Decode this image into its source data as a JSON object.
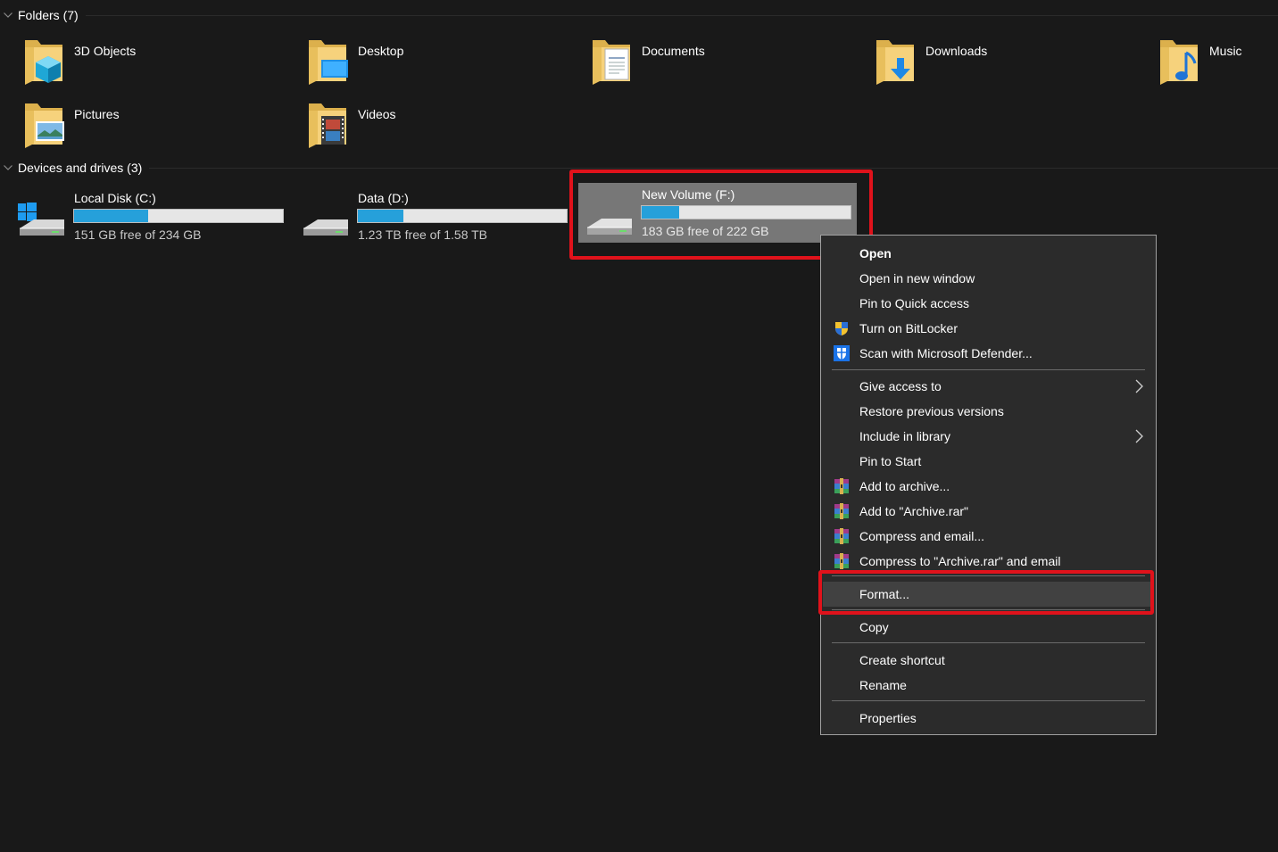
{
  "folders_group": {
    "title": "Folders (7)"
  },
  "folders": [
    {
      "name": "3D Objects",
      "icon": "3d-objects-folder-icon"
    },
    {
      "name": "Desktop",
      "icon": "desktop-folder-icon"
    },
    {
      "name": "Documents",
      "icon": "documents-folder-icon"
    },
    {
      "name": "Downloads",
      "icon": "downloads-folder-icon"
    },
    {
      "name": "Music",
      "icon": "music-folder-icon"
    },
    {
      "name": "Pictures",
      "icon": "pictures-folder-icon"
    },
    {
      "name": "Videos",
      "icon": "videos-folder-icon"
    }
  ],
  "drives_group": {
    "title": "Devices and drives (3)"
  },
  "drives": [
    {
      "name": "Local Disk (C:)",
      "free": "151 GB free of 234 GB",
      "used_fraction": 0.355,
      "icon": "windows-drive-icon"
    },
    {
      "name": "Data (D:)",
      "free": "1.23 TB free of 1.58 TB",
      "used_fraction": 0.22,
      "icon": "hard-drive-icon"
    },
    {
      "name": "New Volume (F:)",
      "free": "183 GB free of 222 GB",
      "used_fraction": 0.18,
      "icon": "hard-drive-icon",
      "selected": true
    }
  ],
  "context_menu": {
    "items": [
      {
        "label": "Open",
        "bold": true
      },
      {
        "label": "Open in new window"
      },
      {
        "label": "Pin to Quick access"
      },
      {
        "label": "Turn on BitLocker",
        "icon": "bitlocker-shield-icon"
      },
      {
        "label": "Scan with Microsoft Defender...",
        "icon": "defender-shield-icon"
      },
      {
        "label": "Give access to",
        "submenu": true
      },
      {
        "label": "Restore previous versions"
      },
      {
        "label": "Include in library",
        "submenu": true
      },
      {
        "label": "Pin to Start"
      },
      {
        "label": "Add to archive...",
        "icon": "winrar-icon"
      },
      {
        "label": "Add to \"Archive.rar\"",
        "icon": "winrar-icon"
      },
      {
        "label": "Compress and email...",
        "icon": "winrar-icon"
      },
      {
        "label": "Compress to \"Archive.rar\" and email",
        "icon": "winrar-icon"
      },
      {
        "label": "Format...",
        "hovered": true
      },
      {
        "label": "Copy"
      },
      {
        "label": "Create shortcut"
      },
      {
        "label": "Rename"
      },
      {
        "label": "Properties"
      }
    ]
  },
  "colors": {
    "background": "#191919",
    "menu_background": "#2b2b2b",
    "highlight_red": "#e0121b",
    "drive_bar_fill": "#26a0da",
    "selection": "#777777"
  }
}
